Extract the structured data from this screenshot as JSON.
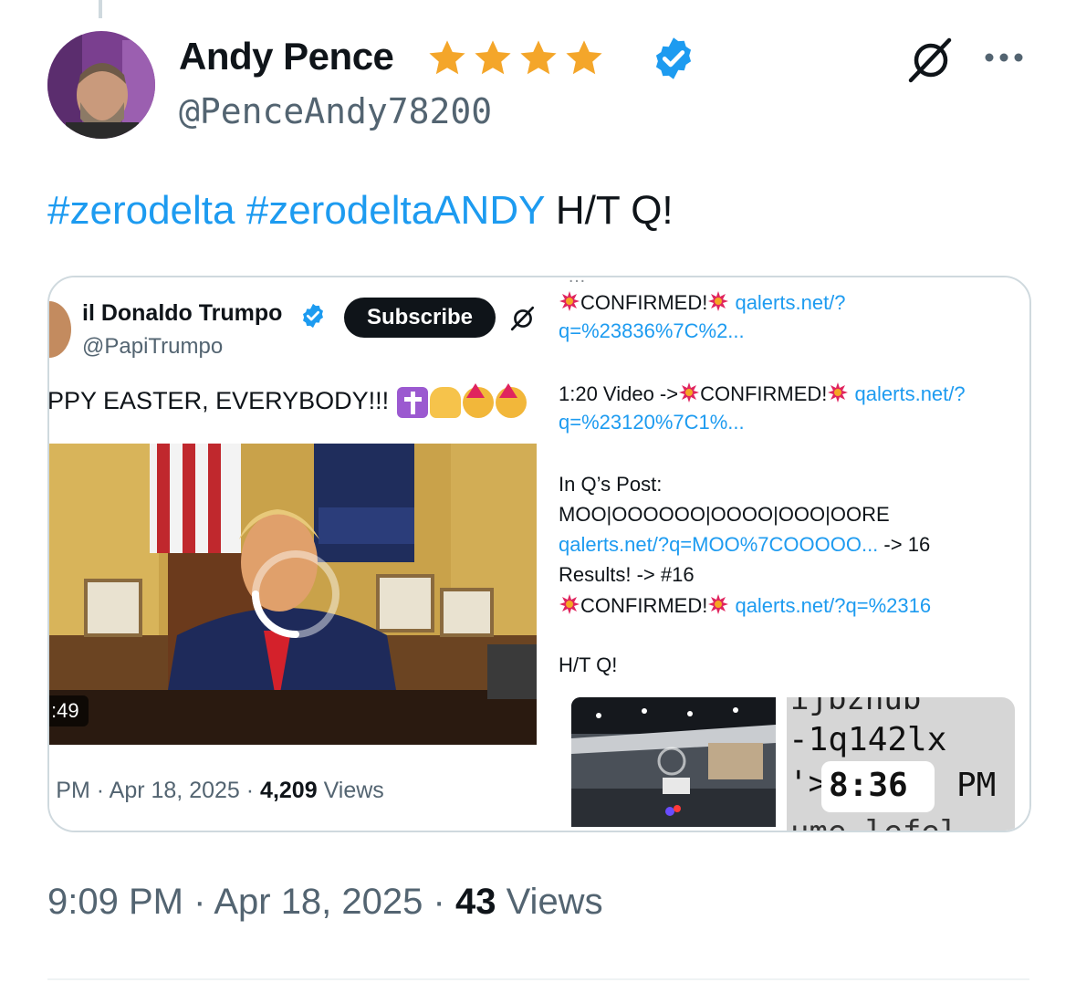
{
  "post": {
    "author": {
      "display_name": "Andy Pence",
      "handle": "@PenceAndy78200",
      "badges": [
        "star-icon",
        "star-icon",
        "star-icon",
        "star-icon",
        "verified-badge-icon"
      ]
    },
    "text": {
      "hashtag_1": "#zerodelta",
      "hashtag_2": "#zerodeltaANDY",
      "suffix": "H/T Q!"
    },
    "time": "9:09 PM",
    "separator": "·",
    "date": "Apr 18, 2025",
    "views_count": "43",
    "views_label": "Views"
  },
  "media": {
    "left": {
      "name": "il Donaldo Trumpo",
      "handle": "@PapiTrumpo",
      "subscribe_label": "Subscribe",
      "text": "PPY EASTER, EVERYBODY!!!",
      "emoji": [
        "cross-emoji",
        "pray-emoji",
        "party-face-emoji",
        "party-face-emoji"
      ],
      "video_timer": ":49",
      "meta_time": ") PM",
      "meta_date": "Apr 18, 2025",
      "meta_views_count": "4,209",
      "meta_views_label": "Views"
    },
    "right": {
      "cut_text": "…",
      "confirmed": "CONFIRMED!",
      "line1_link": "qalerts.net/?",
      "line2_link": "q=%23836%7C%2...",
      "line3_prefix": "1:20 Video ->",
      "line3_link": "qalerts.net/?",
      "line4_link": "q=%23120%7C1%...",
      "line5": "In Q’s Post:",
      "line6": "MOO|OOOOOO|OOOO|OOO|OORE",
      "line7_link": "qalerts.net/?q=MOO%7COOOOO...",
      "line7_suffix": "-> 16",
      "line8": "Results! -> #16",
      "line9_link": "qalerts.net/?q=%2316",
      "line10": "H/T Q!",
      "thumb_text_a": "ijbznub",
      "thumb_text_b": "-1q142lx",
      "thumb_text_c": "'>",
      "thumb_time": "8:36",
      "thumb_pm": "PM",
      "thumb_text_d": "ume lefel"
    }
  },
  "colors": {
    "link": "#1d9bf0",
    "secondary_text": "#536471",
    "primary_text": "#0f1419",
    "star": "#f4a62a",
    "card_border": "#cfd9de"
  }
}
